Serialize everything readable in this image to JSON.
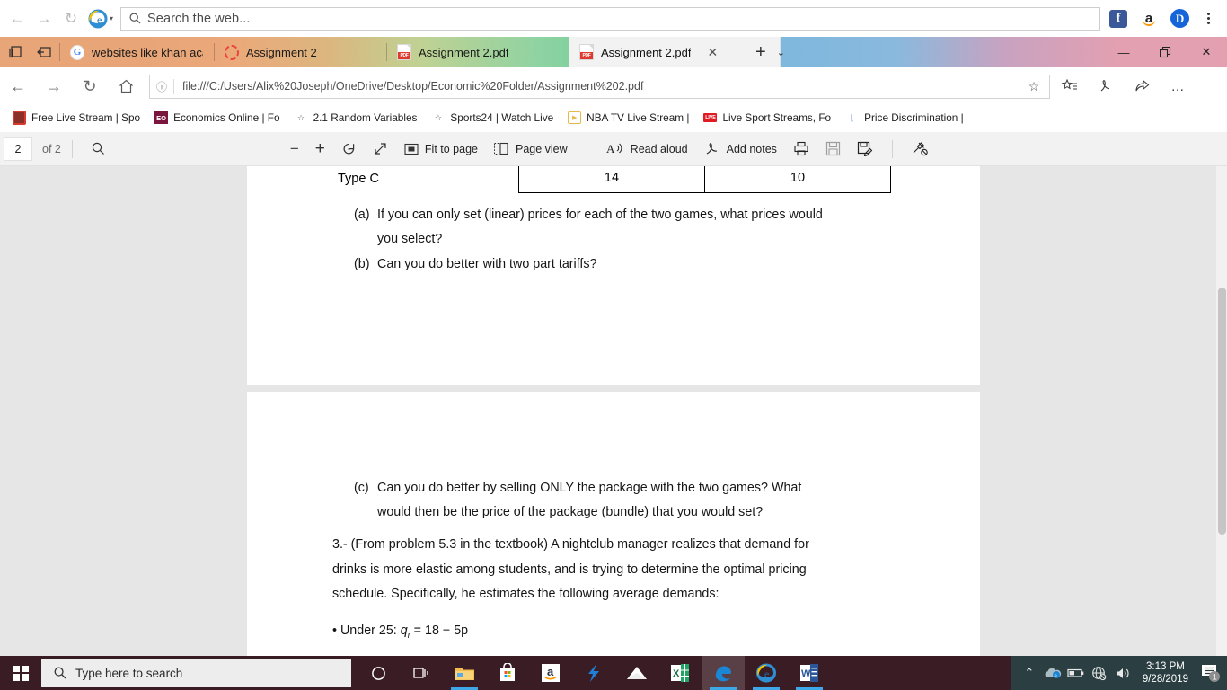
{
  "browser": {
    "search": {
      "placeholder": "Search the web...",
      "icon": "search-icon"
    },
    "logo_caret": "▾",
    "quicklinks": [
      {
        "name": "facebook-icon",
        "label": "f"
      },
      {
        "name": "amazon-icon",
        "label": "a"
      },
      {
        "name": "disqus-icon",
        "label": "D"
      }
    ],
    "tabs": [
      {
        "title": "websites like khan academy",
        "favicon": "google-icon",
        "active": false
      },
      {
        "title": "Assignment 2",
        "favicon": "loading-ring-icon",
        "active": false
      },
      {
        "title": "Assignment 2.pdf",
        "favicon": "pdf-icon",
        "active": false
      },
      {
        "title": "Assignment 2.pdf",
        "favicon": "pdf-icon",
        "active": true
      }
    ],
    "tab_close_glyph": "✕",
    "new_tab_glyph": "+",
    "tab_dropdown_glyph": "⌄",
    "window_controls": {
      "minimize": "—",
      "restore": "❐",
      "close": "✕"
    },
    "nav": {
      "back": "←",
      "forward": "→",
      "refresh": "↻",
      "home": "⌂"
    },
    "address": {
      "info_glyph": "ⓘ",
      "url": "file:///C:/Users/Alix%20Joseph/OneDrive/Desktop/Economic%20Folder/Assignment%202.pdf",
      "favorite_glyph": "☆"
    },
    "address_actions": [
      {
        "name": "add-to-favorites-list-icon",
        "glyph": "☆"
      },
      {
        "name": "web-notes-icon",
        "glyph": "✎"
      },
      {
        "name": "share-icon",
        "glyph": "↪"
      },
      {
        "name": "settings-more-icon",
        "glyph": "…"
      }
    ],
    "favorites": [
      {
        "label": "Free Live Stream | Spo",
        "icon": "tv-icon"
      },
      {
        "label": "Economics Online | Fo",
        "icon": "eo-icon"
      },
      {
        "label": "2.1 Random Variables",
        "icon": "star-icon"
      },
      {
        "label": "Sports24 | Watch Live",
        "icon": "star-icon"
      },
      {
        "label": "NBA TV Live Stream |",
        "icon": "play-icon"
      },
      {
        "label": "Live Sport Streams, Fo",
        "icon": "live-icon"
      },
      {
        "label": "Price Discrimination |",
        "icon": "bookmark-icon"
      }
    ]
  },
  "pdf_toolbar": {
    "page_number": "2",
    "page_total": "of 2",
    "search_glyph": "⚲",
    "zoom_out": "−",
    "zoom_in": "+",
    "rotate_label": "rotate-icon",
    "fullscreen_label": "fullscreen-icon",
    "fit_to_page": "Fit to page",
    "page_view": "Page view",
    "read_aloud": "Read aloud",
    "add_notes": "Add notes",
    "print_label": "print-icon",
    "save_label": "save-icon",
    "save_as_label": "save-as-icon",
    "pin_label": "unpin-icon"
  },
  "document": {
    "page1": {
      "table_row_label": "Type C",
      "table_values": [
        "14",
        "10"
      ],
      "questions": [
        {
          "marker": "(a)",
          "line1": "If you can only set (linear) prices for each of the two games, what prices would",
          "line2": "you select?"
        },
        {
          "marker": "(b)",
          "line1": "Can you do better with two part tariffs?",
          "line2": ""
        }
      ]
    },
    "page2": {
      "question_c": {
        "marker": "(c)",
        "line1": "Can you do better by selling ONLY the package with the two games? What",
        "line2": "would then be the price of the package (bundle) that you would set?"
      },
      "problem3": [
        "3.- (From problem 5.3 in the textbook) A nightclub manager realizes that demand for",
        "drinks is more elastic among students, and is trying to determine the optimal pricing",
        "schedule. Specifically, he estimates the following average demands:"
      ],
      "bullet": {
        "prefix": "• Under 25: ",
        "var": "q",
        "sub": "r",
        "equation": " = 18 − 5p"
      }
    }
  },
  "taskbar": {
    "search_placeholder": "Type here to search",
    "cortana_glyph": "○",
    "taskview_glyph": "⌸",
    "apps": [
      {
        "name": "file-explorer-icon",
        "active": false,
        "running": true
      },
      {
        "name": "microsoft-store-icon",
        "active": false,
        "running": false
      },
      {
        "name": "amazon-icon",
        "active": false,
        "running": false
      },
      {
        "name": "s-app-icon",
        "active": false,
        "running": false
      },
      {
        "name": "mail-icon",
        "active": false,
        "running": false
      },
      {
        "name": "excel-icon",
        "active": false,
        "running": false
      },
      {
        "name": "microsoft-edge-icon",
        "active": true,
        "running": true
      },
      {
        "name": "internet-explorer-icon",
        "active": false,
        "running": true
      },
      {
        "name": "word-icon",
        "active": false,
        "running": true
      }
    ],
    "tray": {
      "expand_glyph": "⌃",
      "onedrive": "onedrive-icon",
      "battery": "battery-icon",
      "network": "network-offline-icon",
      "volume": "volume-icon",
      "time": "3:13 PM",
      "date": "9/28/2019",
      "notification_count": "1"
    }
  },
  "colors": {
    "tabbar_orange": "#e8a578",
    "tabbar_green": "#7fcf9c",
    "tabbar_blue": "#8ab9dd",
    "tabbar_pink": "#e3a0b0",
    "taskbar": "#3a1c24",
    "tray": "#2b3f42",
    "doc_bg": "#e6e6e6",
    "accent_blue": "#3da7e8"
  }
}
